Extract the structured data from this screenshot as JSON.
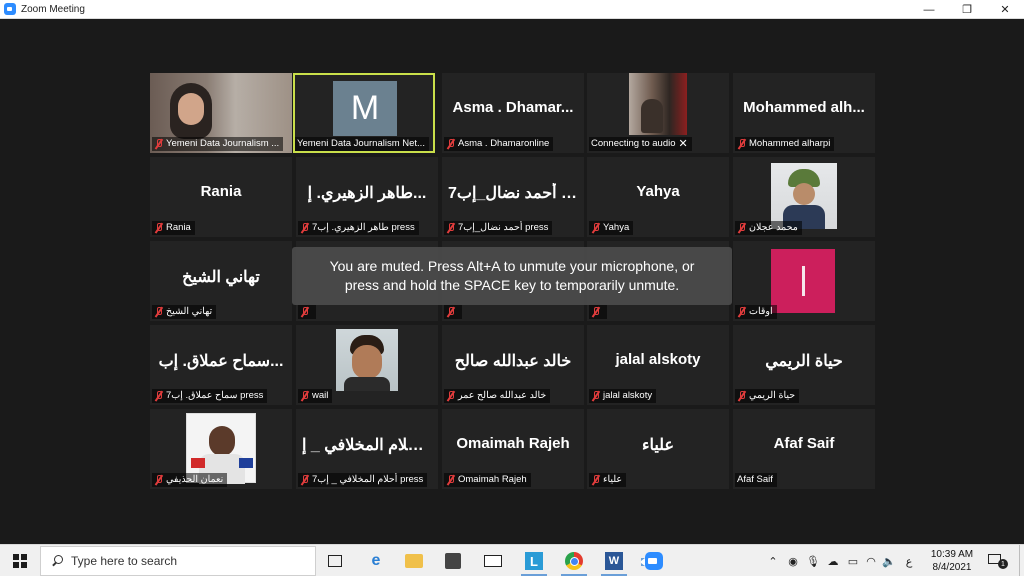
{
  "window": {
    "title": "Zoom Meeting",
    "minimize_glyph": "—",
    "restore_glyph": "❐",
    "close_glyph": "✕"
  },
  "participants": [
    {
      "id": "p1",
      "display_name": "",
      "label": "Yemeni Data Journalism ...",
      "muted": true,
      "kind": "photo-woman"
    },
    {
      "id": "p2",
      "display_name": "",
      "label": "Yemeni Data Journalism Net...",
      "muted": false,
      "kind": "initial",
      "initial": "M",
      "active_speaker": true
    },
    {
      "id": "p3",
      "display_name": "Asma . Dhamar...",
      "label": "Asma . Dhamaronline",
      "muted": true,
      "kind": "name"
    },
    {
      "id": "p4",
      "display_name": "",
      "label": "Connecting to audio",
      "muted": false,
      "kind": "photo-connecting"
    },
    {
      "id": "p5",
      "display_name": "Mohammed alh...",
      "label": "Mohammed alharpi",
      "muted": true,
      "kind": "name"
    },
    {
      "id": "p6",
      "display_name": "Rania",
      "label": "Rania",
      "muted": true,
      "kind": "name"
    },
    {
      "id": "p7",
      "display_name": "طاهر الزهيري. إ...",
      "label": "طاهر الزهيري. إب7 press",
      "muted": true,
      "kind": "name"
    },
    {
      "id": "p8",
      "display_name": "أحمد نضال_إب7 p...",
      "label": "أحمد نضال_إب7 press",
      "muted": true,
      "kind": "name"
    },
    {
      "id": "p9",
      "display_name": "Yahya",
      "label": "Yahya",
      "muted": true,
      "kind": "name"
    },
    {
      "id": "p10",
      "display_name": "",
      "label": "محمد عجلان",
      "muted": true,
      "kind": "photo-mohammed"
    },
    {
      "id": "p11",
      "display_name": "تهاني الشيخ",
      "label": "تهاني الشيخ",
      "muted": true,
      "kind": "name"
    },
    {
      "id": "p12",
      "display_name": "",
      "label": "",
      "muted": true,
      "kind": "hidden"
    },
    {
      "id": "p13",
      "display_name": "",
      "label": "",
      "muted": true,
      "kind": "hidden"
    },
    {
      "id": "p14",
      "display_name": "",
      "label": "",
      "muted": true,
      "kind": "hidden"
    },
    {
      "id": "p15",
      "display_name": "",
      "label": "اوقات",
      "muted": true,
      "kind": "pink-avatar"
    },
    {
      "id": "p16",
      "display_name": "سماح عملاق. إب...",
      "label": "سماح عملاق. إب7 press",
      "muted": true,
      "kind": "name"
    },
    {
      "id": "p17",
      "display_name": "",
      "label": "wail",
      "muted": true,
      "kind": "photo-wail"
    },
    {
      "id": "p18",
      "display_name": "خالد عبدالله صالح",
      "label": "خالد عبدالله صالح عمر",
      "muted": true,
      "kind": "name"
    },
    {
      "id": "p19",
      "display_name": "jalal alskoty",
      "label": "jalal alskoty",
      "muted": true,
      "kind": "name"
    },
    {
      "id": "p20",
      "display_name": "حياة الريمي",
      "label": "حياة الريمي",
      "muted": true,
      "kind": "name"
    },
    {
      "id": "p21",
      "display_name": "",
      "label": "نعمان الحذيفي",
      "muted": true,
      "kind": "photo-numan"
    },
    {
      "id": "p22",
      "display_name": "أحلام المخلافي _ إ...",
      "label": "أحلام المخلافي _ إب7 press",
      "muted": true,
      "kind": "name"
    },
    {
      "id": "p23",
      "display_name": "Omaimah Rajeh",
      "label": "Omaimah Rajeh",
      "muted": true,
      "kind": "name"
    },
    {
      "id": "p24",
      "display_name": "علياء",
      "label": "علياء",
      "muted": true,
      "kind": "name"
    },
    {
      "id": "p25",
      "display_name": "Afaf Saif",
      "label": "Afaf Saif",
      "muted": false,
      "kind": "name"
    }
  ],
  "mute_toast": {
    "line1": "You are muted. Press Alt+A to unmute your microphone, or",
    "line2": "press and hold the SPACE key to temporarily unmute."
  },
  "taskbar": {
    "search_placeholder": "Type here to search",
    "apps": [
      "task-view",
      "edge",
      "file-explorer",
      "store",
      "mail",
      "l-app",
      "chrome",
      "word",
      "zoom"
    ],
    "tray": {
      "ime": "ع",
      "time": "10:39 AM",
      "date": "8/4/2021",
      "notification_count": "1"
    }
  }
}
